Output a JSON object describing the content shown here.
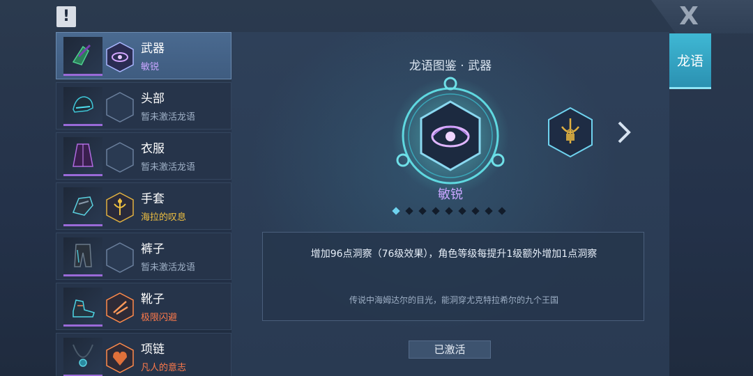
{
  "header": {
    "alert_label": "!",
    "close_label": "X",
    "side_tab_label": "龙语"
  },
  "equipment_slots": [
    {
      "name": "武器",
      "status": "敏锐",
      "status_color": "#c8a6ff",
      "selected": true,
      "icon": "eye-emblem-icon"
    },
    {
      "name": "头部",
      "status": "暂未激活龙语",
      "status_color": "#9fb0c6",
      "selected": false,
      "icon": "empty-hex-icon"
    },
    {
      "name": "衣服",
      "status": "暂未激活龙语",
      "status_color": "#9fb0c6",
      "selected": false,
      "icon": "empty-hex-icon"
    },
    {
      "name": "手套",
      "status": "海拉的叹息",
      "status_color": "#f0c040",
      "selected": false,
      "icon": "golden-crest-icon"
    },
    {
      "name": "裤子",
      "status": "暂未激活龙语",
      "status_color": "#9fb0c6",
      "selected": false,
      "icon": "empty-hex-icon"
    },
    {
      "name": "靴子",
      "status": "极限闪避",
      "status_color": "#ff7a4a",
      "selected": false,
      "icon": "flame-crest-icon"
    },
    {
      "name": "项链",
      "status": "凡人的意志",
      "status_color": "#ff7a4a",
      "selected": false,
      "icon": "heart-crest-icon"
    }
  ],
  "detail": {
    "title": "龙语图鉴 · 武器",
    "emblem_name": "敏锐",
    "page_count": 9,
    "page_active": 1,
    "effect": "增加96点洞察（76级效果），角色等级每提升1级额外增加1点洞察",
    "lore": "传说中海姆达尔的目光，能洞穿尤克特拉希尔的九个王国",
    "activated_label": "已激活"
  },
  "colors": {
    "accent_cyan": "#3fb8d4",
    "rarity_purple": "#9a6ad8"
  }
}
